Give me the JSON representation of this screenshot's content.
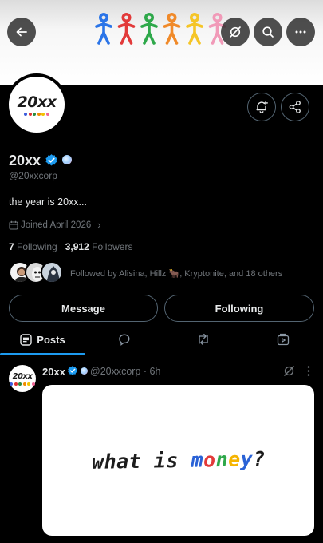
{
  "header": {
    "back_icon": "arrow-left-icon",
    "grok_icon": "grok-icon",
    "search_icon": "search-icon",
    "more_icon": "more-horizontal-icon",
    "banner_figure_colors": [
      "#2a74e8",
      "#e23a3a",
      "#2ea84a",
      "#f08a2a",
      "#f5c527",
      "#f19ab8"
    ]
  },
  "profile": {
    "avatar_text": "20xx",
    "avatar_dot_colors": [
      "#3b5bdb",
      "#e03131",
      "#2b8a3e",
      "#f08c00",
      "#f2c200",
      "#f06595"
    ],
    "name": "20xx",
    "handle": "@20xxcorp",
    "bio": "the year is 20xx...",
    "joined": "Joined April 2026",
    "following_count": "7",
    "following_label": "Following",
    "followers_count": "3,912",
    "followers_label": "Followers",
    "followed_by": "Followed by Alisina, Hillz 🐂, Kryptonite, and 18 others",
    "accent": "#1d9bf0"
  },
  "actions": {
    "message_label": "Message",
    "following_label": "Following",
    "notify_icon": "bell-plus-icon",
    "share_icon": "share-icon"
  },
  "tabs": {
    "posts_label": "Posts"
  },
  "post": {
    "name": "20xx",
    "meta": "@20xxcorp · 6h",
    "card_text_parts": [
      "what is ",
      "m",
      "o",
      "n",
      "e",
      "y",
      "?"
    ],
    "card_text_colors": [
      "#1c1c1c",
      "#2a62d6",
      "#e23a3a",
      "#2ea84a",
      "#f5b400",
      "#2a62d6",
      "#1c1c1c"
    ]
  }
}
